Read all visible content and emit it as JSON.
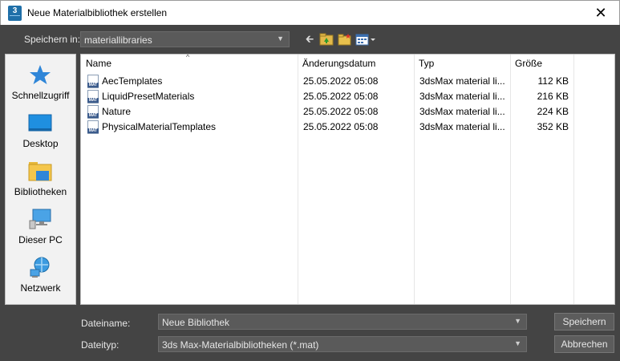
{
  "window": {
    "title": "Neue Materialbibliothek erstellen",
    "app_icon": {
      "number": "3",
      "name": "3ds-max-icon"
    },
    "close_glyph": "✕"
  },
  "toolbar": {
    "savein_label": "Speichern in:",
    "savein_value": "materiallibraries",
    "icons": [
      "back-arrow-icon",
      "up-folder-icon",
      "new-folder-icon",
      "view-menu-icon"
    ]
  },
  "places": [
    {
      "label": "Schnellzugriff",
      "icon": "star-icon"
    },
    {
      "label": "Desktop",
      "icon": "desktop-icon"
    },
    {
      "label": "Bibliotheken",
      "icon": "libraries-folder-icon"
    },
    {
      "label": "Dieser PC",
      "icon": "computer-icon"
    },
    {
      "label": "Netzwerk",
      "icon": "network-icon"
    }
  ],
  "filelist": {
    "columns": [
      "Name",
      "Änderungsdatum",
      "Typ",
      "Größe"
    ],
    "rows": [
      {
        "name": "AecTemplates",
        "date": "25.05.2022 05:08",
        "type": "3dsMax material li...",
        "size": "112 KB"
      },
      {
        "name": "LiquidPresetMaterials",
        "date": "25.05.2022 05:08",
        "type": "3dsMax material li...",
        "size": "216 KB"
      },
      {
        "name": "Nature",
        "date": "25.05.2022 05:08",
        "type": "3dsMax material li...",
        "size": "224 KB"
      },
      {
        "name": "PhysicalMaterialTemplates",
        "date": "25.05.2022 05:08",
        "type": "3dsMax material li...",
        "size": "352 KB"
      }
    ]
  },
  "bottom": {
    "filename_label": "Dateiname:",
    "filename_value": "Neue Bibliothek",
    "filetype_label": "Dateityp:",
    "filetype_value": "3ds Max-Materialbibliotheken (*.mat)",
    "save_button": "Speichern",
    "cancel_button": "Abbrechen"
  },
  "colors": {
    "dialog_bg": "#444444",
    "titlebar_bg": "#ffffff",
    "combo_bg": "#5a5a5a",
    "list_bg": "#ffffff",
    "accent_blue": "#1f6fa8"
  }
}
